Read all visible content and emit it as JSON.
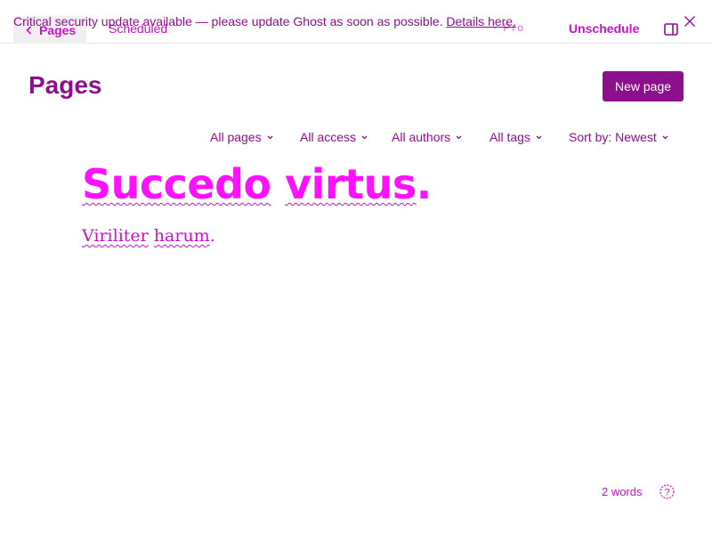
{
  "header": {
    "back_label": "Pages",
    "status": "Scheduled",
    "faint_label": "· Pro",
    "banner_text": "Critical security update available — please update Ghost as soon as possible.",
    "banner_link": "Details here.",
    "unschedule_label": "Unschedule"
  },
  "list": {
    "title": "Pages",
    "new_button": "New page",
    "filters": [
      "All pages",
      "All access",
      "All authors",
      "All tags",
      "Sort by: Newest"
    ]
  },
  "editor": {
    "title_words": [
      "Succedo",
      "virtus"
    ],
    "title_punct": ".",
    "body_words": [
      "Viriliter",
      "harum"
    ],
    "body_punct": ".",
    "word_count": "2 words",
    "help_icon": "help-circle-icon"
  },
  "colors": {
    "brand": "#8d0f8d",
    "accent": "#ff10ff",
    "text": "#cc10cc"
  }
}
